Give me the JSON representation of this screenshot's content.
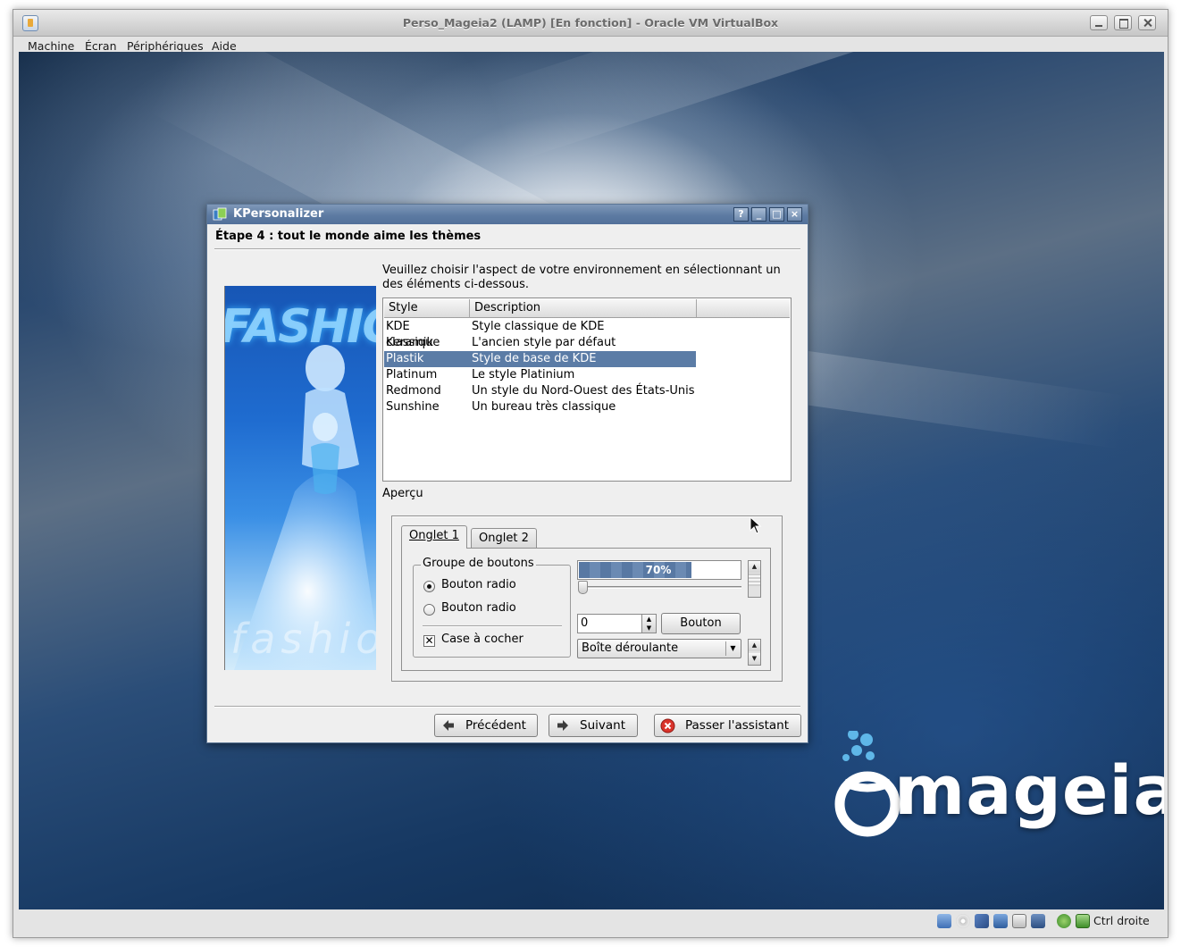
{
  "host": {
    "title": "Perso_Mageia2 (LAMP) [En fonction] - Oracle VM VirtualBox",
    "menu": [
      "Machine",
      "Écran",
      "Périphériques",
      "Aide"
    ],
    "status": {
      "host_key": "Ctrl droite",
      "icons": [
        "hard-disk-icon",
        "optical-drive-icon",
        "usb-icon",
        "network-icon",
        "shared-folders-icon",
        "video-capture-icon",
        "mouse-integration-icon",
        "keyboard-capture-icon"
      ]
    }
  },
  "desktop": {
    "logo_text": "mageia"
  },
  "kpersonalizer": {
    "title": "KPersonalizer",
    "titlebar_buttons": [
      "?",
      "_",
      "□",
      "×"
    ],
    "step_title": "Étape 4 : tout le monde aime les thèmes",
    "intro": "Veuillez choisir l'aspect de votre environnement en sélectionnant un des éléments ci-dessous.",
    "image_text_top": "FASHION",
    "image_text_bottom": "fashio",
    "list": {
      "columns": [
        "Style",
        "Description"
      ],
      "rows": [
        {
          "style": "KDE classique",
          "description": "Style classique de KDE"
        },
        {
          "style": "Keramik",
          "description": "L'ancien style par défaut"
        },
        {
          "style": "Plastik",
          "description": "Style de base de KDE"
        },
        {
          "style": "Platinum",
          "description": "Le style Platinium"
        },
        {
          "style": "Redmond",
          "description": "Un style du Nord-Ouest des États-Unis"
        },
        {
          "style": "Sunshine",
          "description": "Un bureau très classique"
        }
      ],
      "selected": "Plastik"
    },
    "preview": {
      "label": "Aperçu",
      "tabs": {
        "tab1": "Onglet 1",
        "tab2": "Onglet 2"
      },
      "group_title": "Groupe de boutons",
      "radio1": "Bouton radio",
      "radio2": "Bouton radio",
      "radio1_checked": true,
      "checkbox": "Case à cocher",
      "checkbox_checked": true,
      "progress_text": "70%",
      "progress_value": 0.7,
      "spin_value": "0",
      "button": "Bouton",
      "combo": "Boîte déroulante"
    },
    "buttons": {
      "previous": "Précédent",
      "next": "Suivant",
      "skip": "Passer l'assistant"
    }
  }
}
